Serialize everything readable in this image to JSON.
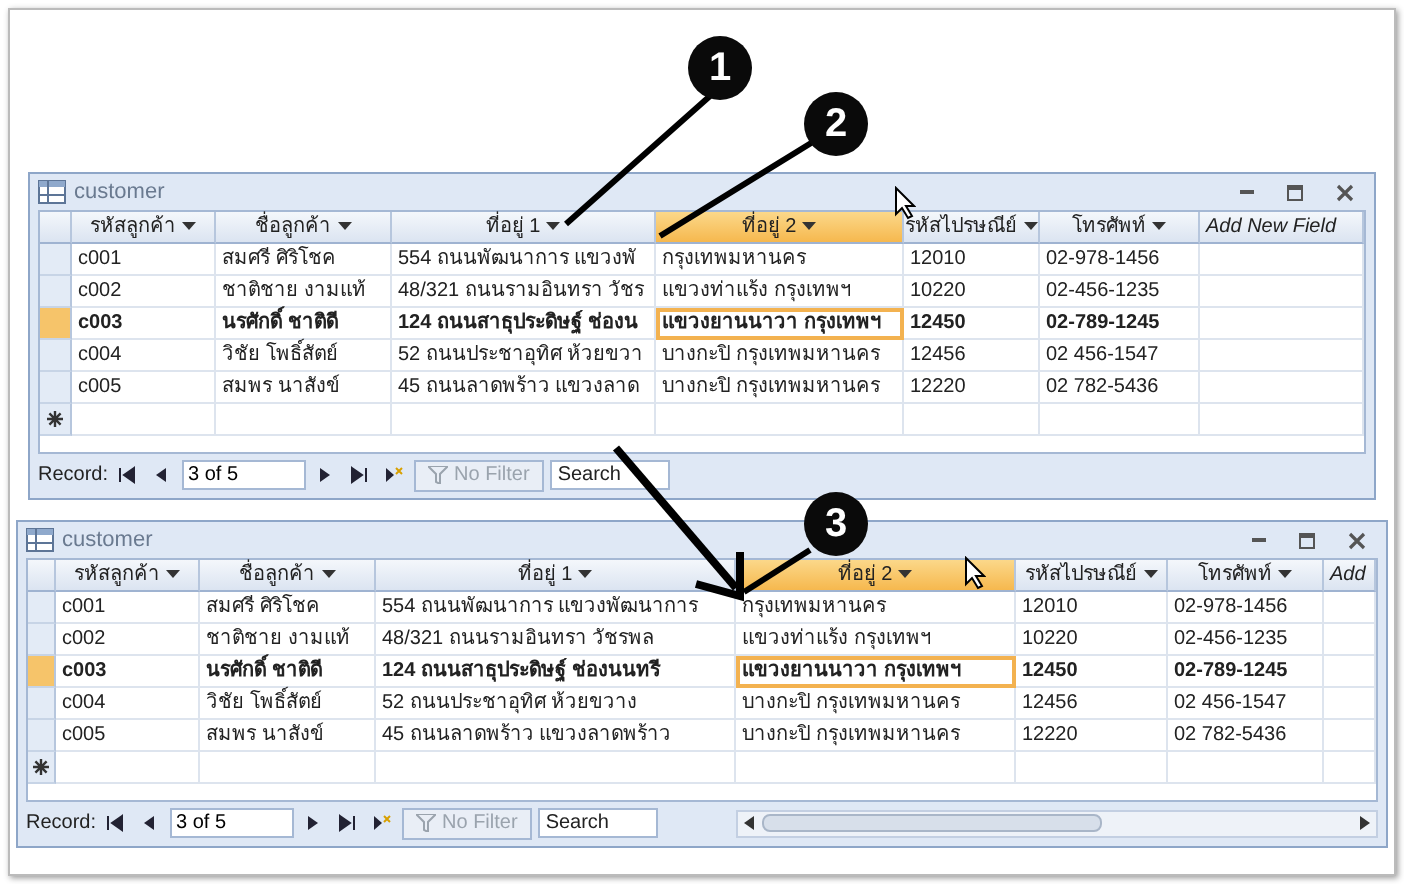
{
  "callouts": [
    {
      "label": "1"
    },
    {
      "label": "2"
    },
    {
      "label": "3"
    }
  ],
  "windows": [
    {
      "title": "customer",
      "scrollbar": false,
      "columns": [
        {
          "label": "รหัสลูกค้า",
          "selected": false
        },
        {
          "label": "ชื่อลูกค้า",
          "selected": false
        },
        {
          "label": "ที่อยู่ 1",
          "selected": false
        },
        {
          "label": "ที่อยู่ 2",
          "selected": true
        },
        {
          "label": "รหัสไปรษณีย์",
          "selected": false
        },
        {
          "label": "โทรศัพท์",
          "selected": false
        },
        {
          "label": "Add New Field",
          "selected": false
        }
      ],
      "rows": [
        {
          "selected": false,
          "cells": [
            "c001",
            "สมศรี ศิริโชค",
            "554 ถนนพัฒนาการ แขวงพั",
            "กรุงเทพมหานคร",
            "12010",
            "02-978-1456"
          ]
        },
        {
          "selected": false,
          "cells": [
            "c002",
            "ชาติชาย งามแท้",
            "48/321 ถนนรามอินทรา วัชร",
            "แขวงท่าแร้ง กรุงเทพฯ",
            "10220",
            "02-456-1235"
          ]
        },
        {
          "selected": true,
          "cells": [
            "c003",
            "นรศักดิ์ ชาติดี",
            "124 ถนนสาธุประดิษฐ์ ช่องน",
            "แขวงยานนาวา กรุงเทพฯ",
            "12450",
            "02-789-1245"
          ]
        },
        {
          "selected": false,
          "cells": [
            "c004",
            "วิชัย โพธิ์สัตย์",
            "52 ถนนประชาอุทิศ ห้วยขวา",
            "บางกะปิ กรุงเทพมหานคร",
            "12456",
            "02 456-1547"
          ]
        },
        {
          "selected": false,
          "cells": [
            "c005",
            "สมพร นาสังข์",
            "45 ถนนลาดพร้าว แขวงลาด",
            "บางกะปิ กรุงเทพมหานคร",
            "12220",
            "02 782-5436"
          ]
        }
      ],
      "record_label": "Record:",
      "position": "3 of 5",
      "filter": {
        "label": "No Filter",
        "disabled": true
      },
      "search": {
        "placeholder": "Search"
      }
    },
    {
      "title": "customer",
      "scrollbar": true,
      "columns": [
        {
          "label": "รหัสลูกค้า",
          "selected": false
        },
        {
          "label": "ชื่อลูกค้า",
          "selected": false
        },
        {
          "label": "ที่อยู่ 1",
          "selected": false
        },
        {
          "label": "ที่อยู่ 2",
          "selected": true
        },
        {
          "label": "รหัสไปรษณีย์",
          "selected": false
        },
        {
          "label": "โทรศัพท์",
          "selected": false
        },
        {
          "label": "Add",
          "selected": false
        }
      ],
      "rows": [
        {
          "selected": false,
          "cells": [
            "c001",
            "สมศรี ศิริโชค",
            "554 ถนนพัฒนาการ แขวงพัฒนาการ",
            "กรุงเทพมหานคร",
            "12010",
            "02-978-1456"
          ]
        },
        {
          "selected": false,
          "cells": [
            "c002",
            "ชาติชาย งามแท้",
            "48/321 ถนนรามอินทรา วัชรพล",
            "แขวงท่าแร้ง กรุงเทพฯ",
            "10220",
            "02-456-1235"
          ]
        },
        {
          "selected": true,
          "cells": [
            "c003",
            "นรศักดิ์ ชาติดี",
            "124 ถนนสาธุประดิษฐ์ ช่องนนทรี",
            "แขวงยานนาวา กรุงเทพฯ",
            "12450",
            "02-789-1245"
          ]
        },
        {
          "selected": false,
          "cells": [
            "c004",
            "วิชัย โพธิ์สัตย์",
            "52 ถนนประชาอุทิศ ห้วยขวาง",
            "บางกะปิ กรุงเทพมหานคร",
            "12456",
            "02 456-1547"
          ]
        },
        {
          "selected": false,
          "cells": [
            "c005",
            "สมพร นาสังข์",
            "45 ถนนลาดพร้าว แขวงลาดพร้าว",
            "บางกะปิ กรุงเทพมหานคร",
            "12220",
            "02 782-5436"
          ]
        }
      ],
      "record_label": "Record:",
      "position": "3 of 5",
      "filter": {
        "label": "No Filter",
        "disabled": true
      },
      "search": {
        "placeholder": "Search"
      }
    }
  ]
}
